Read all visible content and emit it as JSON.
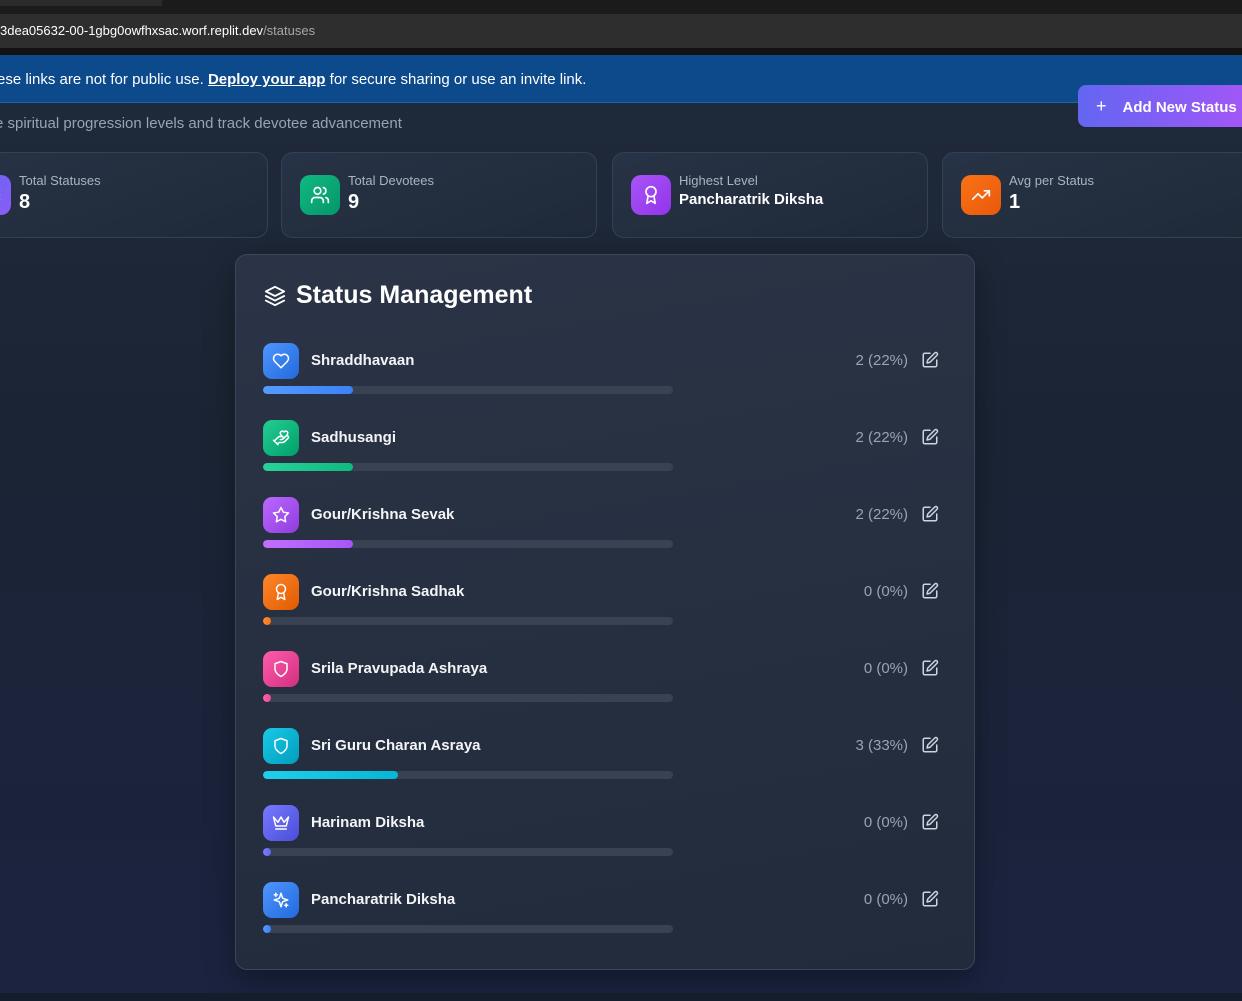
{
  "browser": {
    "url_host": "3dea05632-00-1gbg0owfhxsac.worf.replit.dev",
    "url_path": "/statuses"
  },
  "banner": {
    "text_before": "ese links are not for public use. ",
    "link": "Deploy your app",
    "text_after": " for secure sharing or use an invite link."
  },
  "header": {
    "subtitle": "e spiritual progression levels and track devotee advancement",
    "add_button": "Add New Status"
  },
  "stats": [
    {
      "label": "Total Statuses",
      "value": "8",
      "color": "#6366f1",
      "icon": "layers-icon"
    },
    {
      "label": "Total Devotees",
      "value": "9",
      "color": "#10b981",
      "icon": "users-icon"
    },
    {
      "label": "Highest Level",
      "value": "Pancharatrik Diksha",
      "color": "#a855f7",
      "icon": "award-icon"
    },
    {
      "label": "Avg per Status",
      "value": "1",
      "color": "#f97316",
      "icon": "trending-up-icon"
    }
  ],
  "panel": {
    "title": "Status Management",
    "statuses": [
      {
        "name": "Shraddhavaan",
        "count": "2 (22%)",
        "percent": 22,
        "color": "#3b82f6",
        "icon": "heart-icon"
      },
      {
        "name": "Sadhusangi",
        "count": "2 (22%)",
        "percent": 22,
        "color": "#10b981",
        "icon": "hand-heart-icon"
      },
      {
        "name": "Gour/Krishna Sevak",
        "count": "2 (22%)",
        "percent": 22,
        "color": "#a855f7",
        "icon": "star-icon"
      },
      {
        "name": "Gour/Krishna Sadhak",
        "count": "0 (0%)",
        "percent": 0,
        "color": "#f97316",
        "icon": "award-icon"
      },
      {
        "name": "Srila Pravupada Ashraya",
        "count": "0 (0%)",
        "percent": 0,
        "color": "#ec4899",
        "icon": "shield-icon"
      },
      {
        "name": "Sri Guru Charan Asraya",
        "count": "3 (33%)",
        "percent": 33,
        "color": "#06b6d4",
        "icon": "shield-icon"
      },
      {
        "name": "Harinam Diksha",
        "count": "0 (0%)",
        "percent": 0,
        "color": "#6366f1",
        "icon": "crown-icon"
      },
      {
        "name": "Pancharatrik Diksha",
        "count": "0 (0%)",
        "percent": 0,
        "color": "#3b82f6",
        "icon": "sparkles-icon"
      }
    ]
  }
}
